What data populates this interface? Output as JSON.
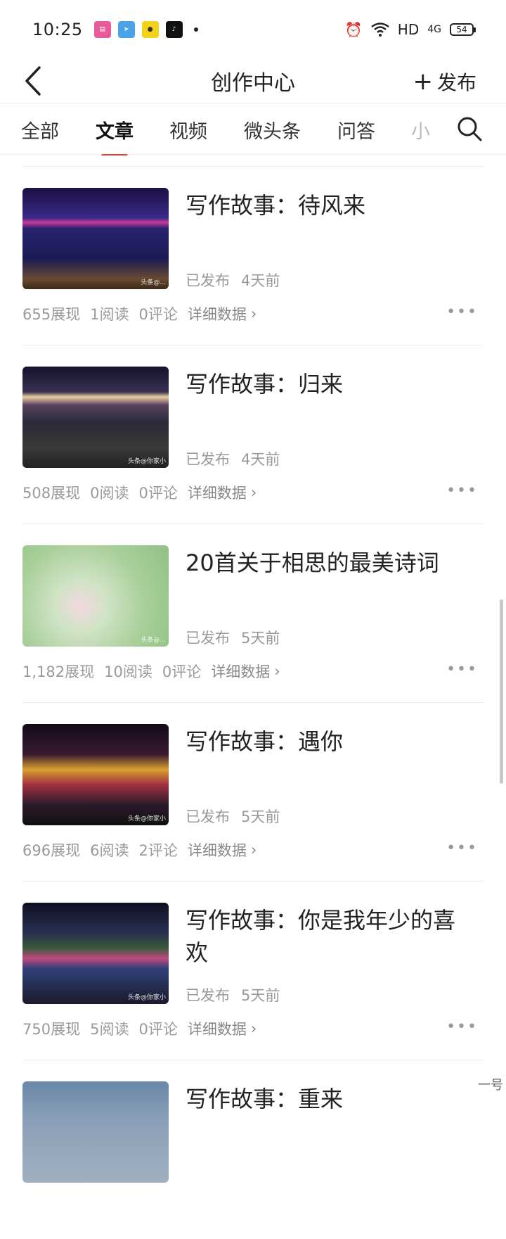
{
  "status_bar": {
    "time": "10:25",
    "notif_apps": [
      "bilibili-icon",
      "telegram-icon",
      "app-yellow-icon",
      "tiktok-icon"
    ],
    "network": "HD",
    "signal": "4G",
    "battery": "54"
  },
  "header": {
    "title": "创作中心",
    "publish_label": "发布",
    "publish_plus": "+"
  },
  "tabs": [
    {
      "label": "全部"
    },
    {
      "label": "文章"
    },
    {
      "label": "视频"
    },
    {
      "label": "微头条"
    },
    {
      "label": "问答"
    },
    {
      "label": "小"
    }
  ],
  "active_tab": "文章",
  "articles": [
    {
      "title": "写作故事：待风来",
      "status": "已发布",
      "time": "4天前",
      "views": "655展现",
      "reads": "1阅读",
      "comments": "0评论",
      "detail": "详细数据",
      "thumb_mark": "头条@..."
    },
    {
      "title": "写作故事：归来",
      "status": "已发布",
      "time": "4天前",
      "views": "508展现",
      "reads": "0阅读",
      "comments": "0评论",
      "detail": "详细数据",
      "thumb_mark": "头条@你家小"
    },
    {
      "title": "20首关于相思的最美诗词",
      "status": "已发布",
      "time": "5天前",
      "views": "1,182展现",
      "reads": "10阅读",
      "comments": "0评论",
      "detail": "详细数据",
      "thumb_mark": "头条@..."
    },
    {
      "title": "写作故事：遇你",
      "status": "已发布",
      "time": "5天前",
      "views": "696展现",
      "reads": "6阅读",
      "comments": "2评论",
      "detail": "详细数据",
      "thumb_mark": "头条@你家小"
    },
    {
      "title": "写作故事：你是我年少的喜欢",
      "status": "已发布",
      "time": "5天前",
      "views": "750展现",
      "reads": "5阅读",
      "comments": "0评论",
      "detail": "详细数据",
      "thumb_mark": "头条@你家小"
    },
    {
      "title": "写作故事：重来",
      "status": "",
      "time": "",
      "views": "",
      "reads": "",
      "comments": "",
      "detail": "",
      "thumb_mark": ""
    }
  ],
  "corner_text": "一号",
  "colors": {
    "accent": "#e33a3a",
    "muted": "#999999"
  }
}
